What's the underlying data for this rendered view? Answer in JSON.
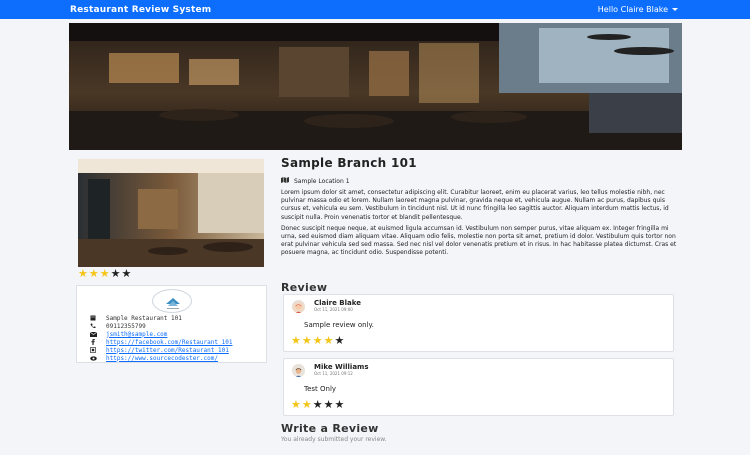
{
  "navbar": {
    "brand": "Restaurant Review System",
    "user_greeting": "Hello Claire Blake",
    "accent": "#0d6efd"
  },
  "branch": {
    "title": "Sample Branch 101",
    "location": "Sample Location 1",
    "rating": 3,
    "max_rating": 5,
    "description": [
      "Lorem ipsum dolor sit amet, consectetur adipiscing elit. Curabitur laoreet, enim eu placerat varius, leo tellus molestie nibh, nec pulvinar massa odio et lorem. Nullam laoreet magna pulvinar, gravida neque et, vehicula augue. Nullam ac purus, dapibus quis cursus et, vehicula eu sem. Vestibulum in tincidunt nisl. Ut id nunc fringilla leo sagittis auctor. Aliquam interdum mattis lectus, id suscipit nulla. Proin venenatis tortor et blandit pellentesque.",
      "Donec suscipit neque neque, at euismod ligula accumsan id. Vestibulum non semper purus, vitae aliquam ex. Integer fringilla mi urna, sed euismod diam aliquam vitae. Aliquam odio felis, molestie non porta sit amet, pretium id dolor. Vestibulum quis tortor non erat pulvinar vehicula sed sed massa. Sed nec nisl vel dolor venenatis pretium et in risus. In hac habitasse platea dictumst. Cras et posuere magna, ac tincidunt odio. Suspendisse potenti."
    ]
  },
  "contact": {
    "name": "Sample Restaurant 101",
    "phone": "09112355799",
    "email": "jsmith@sample.com",
    "facebook": "https://facebook.com/Restaurant_101",
    "twitter": "https://twitter.com/Restaurant_101",
    "website": "https://www.sourcecodester.com/"
  },
  "reviews_heading": "Review",
  "reviews": [
    {
      "name": "Claire Blake",
      "date": "Oct 11, 2021 09:00",
      "text": "Sample review only.",
      "rating": 4
    },
    {
      "name": "Mike Williams",
      "date": "Oct 11, 2021 09:12",
      "text": "Test Only",
      "rating": 2
    }
  ],
  "write_review": {
    "heading": "Write a Review",
    "note": "You already submitted your review."
  },
  "colors": {
    "star_on": "#f5c518",
    "star_off": "#222222",
    "link": "#0d6efd"
  }
}
